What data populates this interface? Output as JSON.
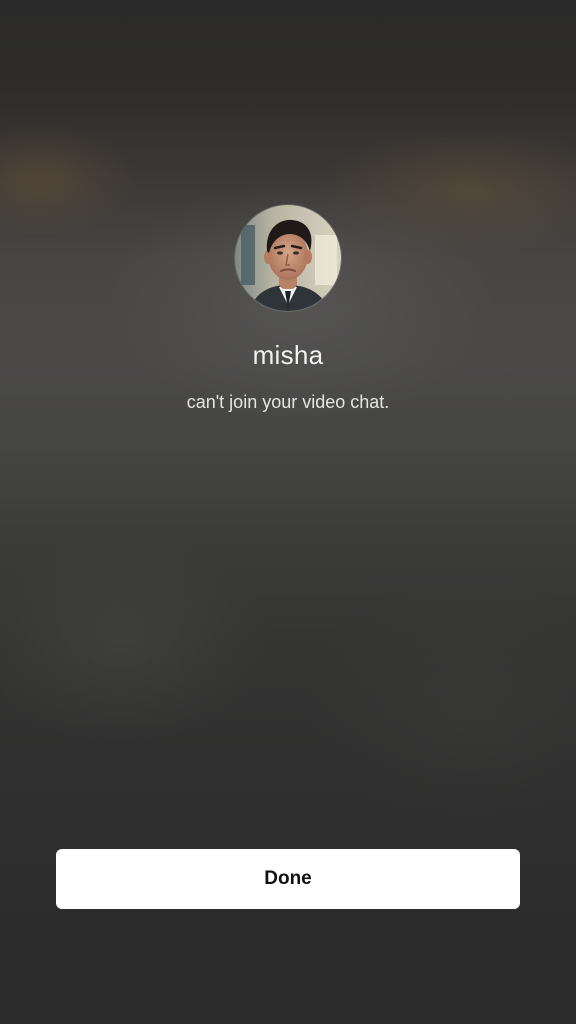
{
  "call_ended": {
    "contact_name": "misha",
    "message": "can't join your video chat.",
    "done_label": "Done",
    "avatar_icon": "profile-photo"
  },
  "colors": {
    "background": "#3a3a3a",
    "text": "#f2f2f2",
    "button_background": "#ffffff",
    "button_text": "#111111"
  }
}
